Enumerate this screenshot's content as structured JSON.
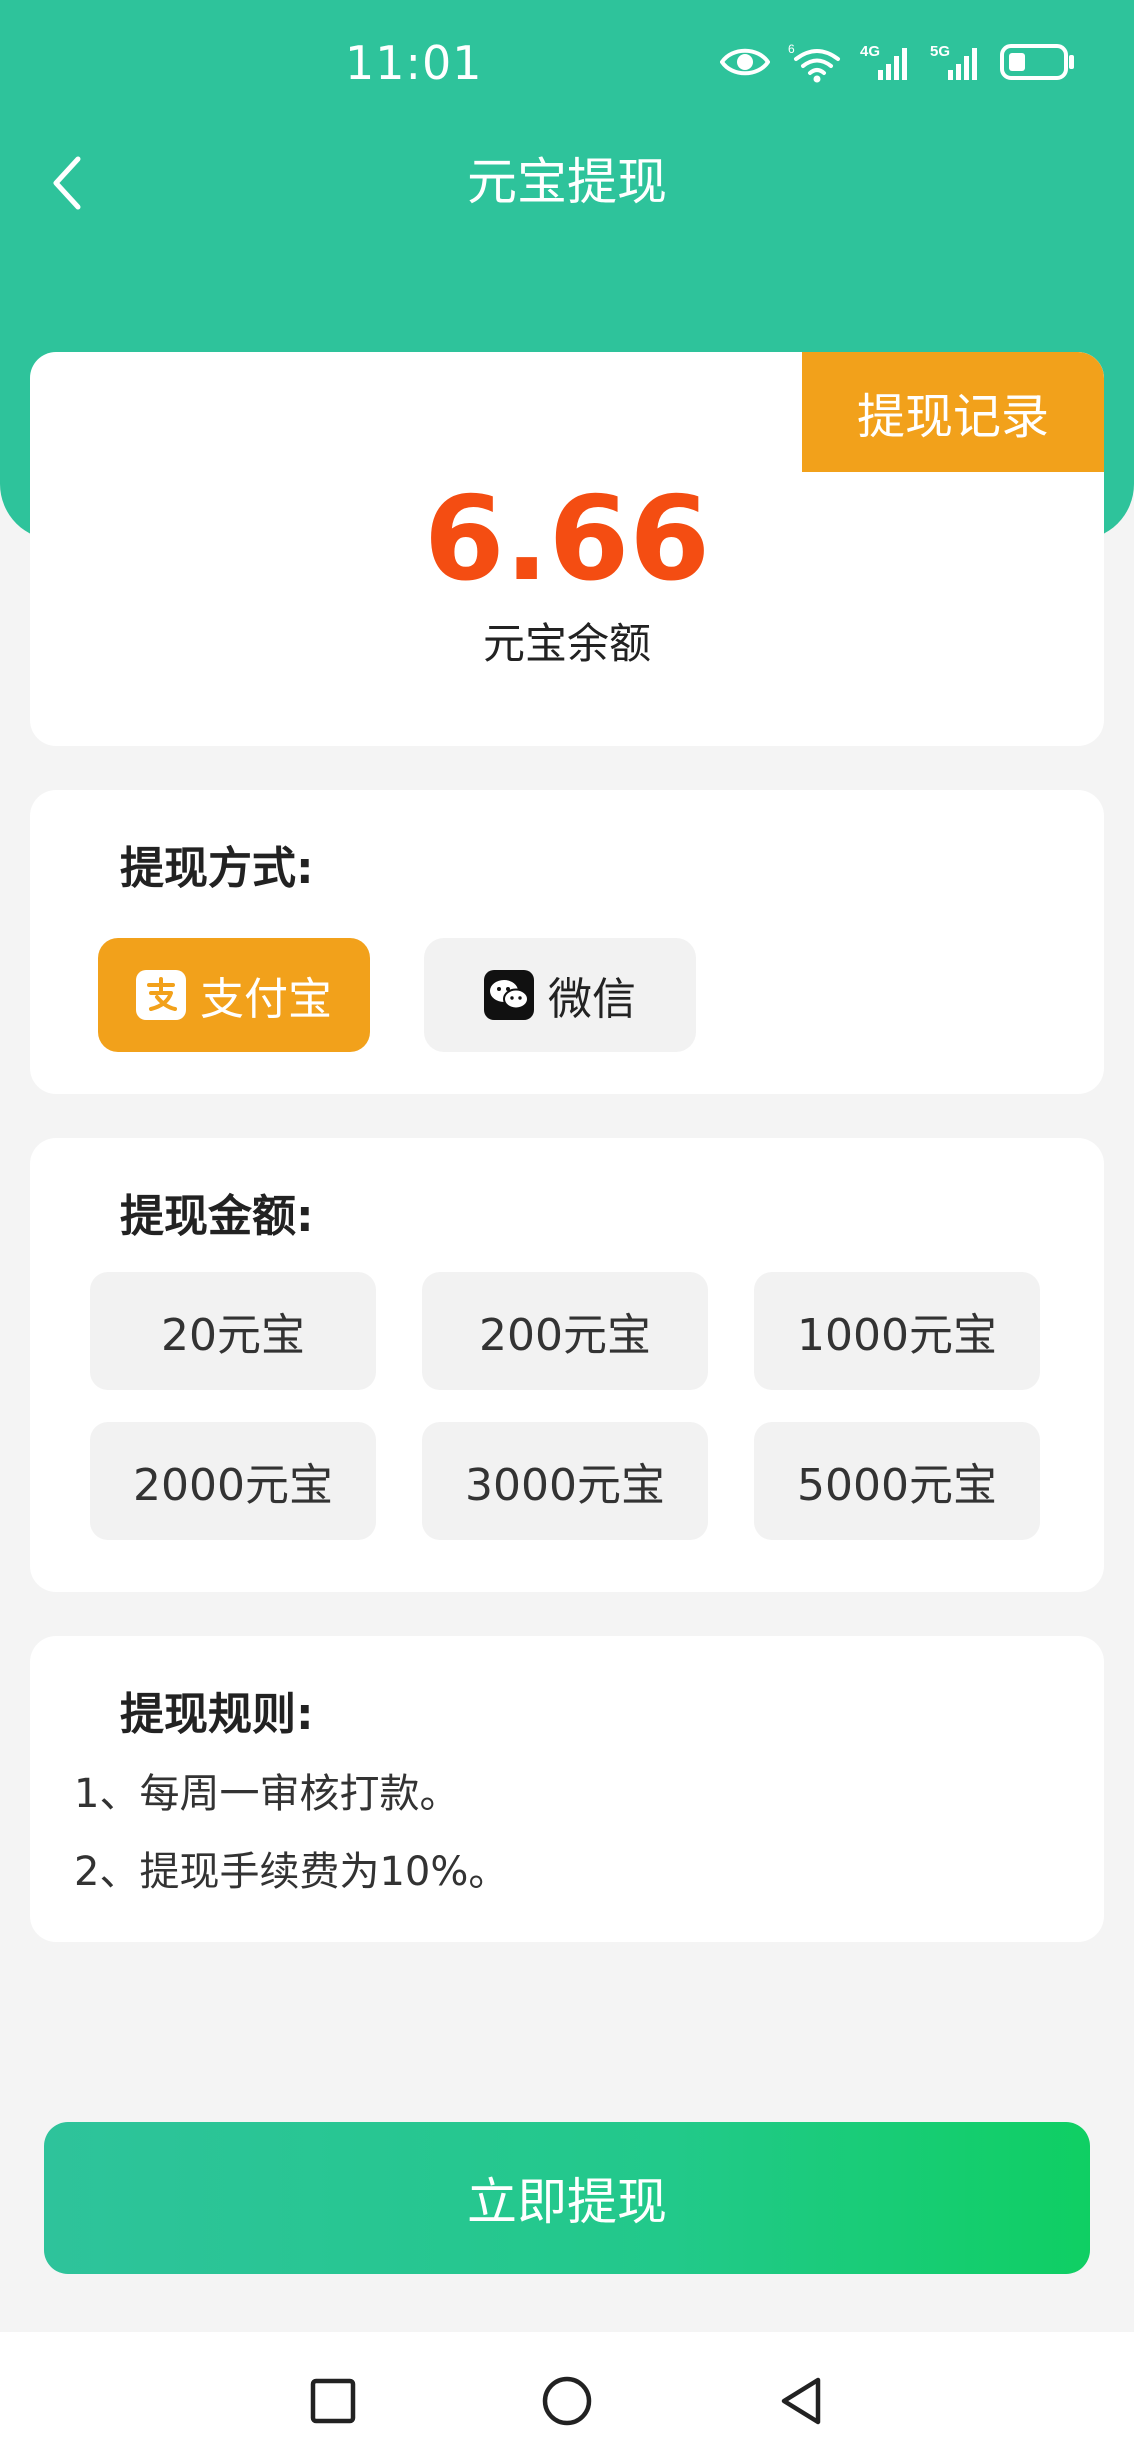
{
  "status_bar": {
    "time": "11:01",
    "icons": [
      "eye-icon",
      "wifi-icon",
      "signal-4g-icon",
      "signal-5g-icon",
      "battery-icon"
    ],
    "wifi_badge": "6",
    "signal_4g_label": "4G",
    "signal_5g_label": "5G"
  },
  "header": {
    "title": "元宝提现",
    "back_icon": "chevron-left-icon"
  },
  "balance": {
    "amount": "6.66",
    "label": "元宝余额",
    "record_button": "提现记录"
  },
  "method": {
    "title": "提现方式:",
    "options": [
      {
        "label": "支付宝",
        "icon": "alipay-icon",
        "selected": true
      },
      {
        "label": "微信",
        "icon": "wechat-icon",
        "selected": false
      }
    ]
  },
  "amount": {
    "title": "提现金额:",
    "options": [
      "20元宝",
      "200元宝",
      "1000元宝",
      "2000元宝",
      "3000元宝",
      "5000元宝"
    ]
  },
  "rules": {
    "title": "提现规则:",
    "items": [
      "1、每周一审核打款。",
      "2、提现手续费为10%。"
    ]
  },
  "submit": {
    "label": "立即提现"
  },
  "system_nav": {
    "items": [
      "recent-apps-icon",
      "home-icon",
      "back-icon"
    ]
  },
  "colors": {
    "primary_green": "#2ec39b",
    "accent_orange": "#f2a11b",
    "balance_red": "#f44d12"
  }
}
